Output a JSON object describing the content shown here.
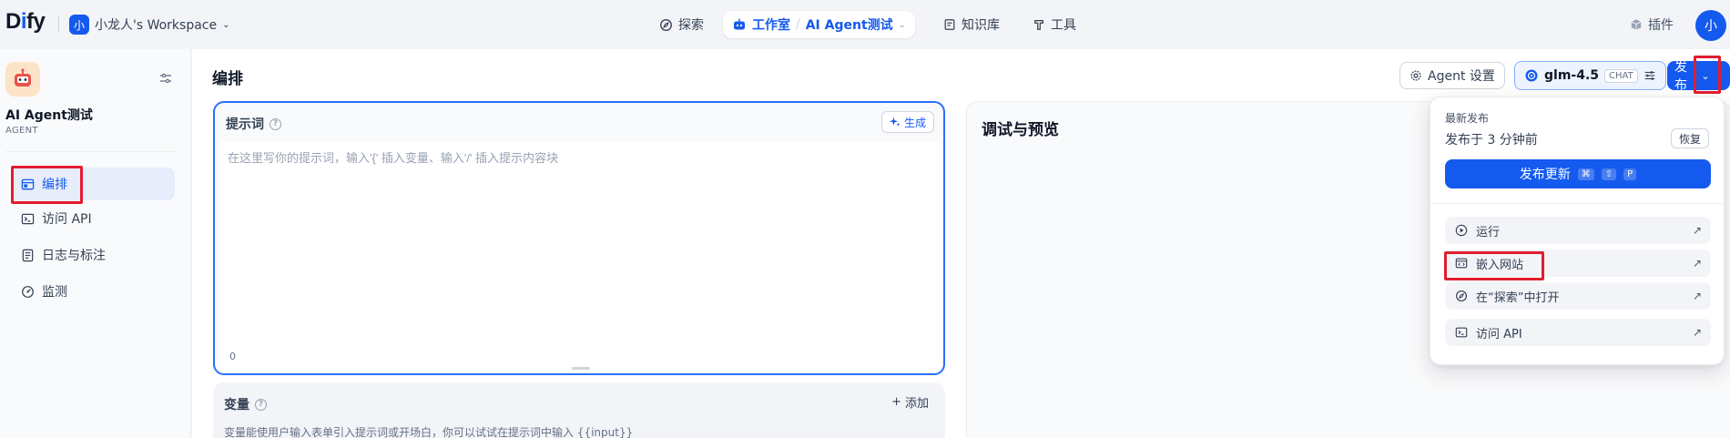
{
  "brand": {
    "logo": "Dify"
  },
  "workspace": {
    "avatar": "小",
    "name": "小龙人's Workspace"
  },
  "nav": {
    "explore": "探索",
    "studio": "工作室",
    "current_app": "AI Agent测试",
    "knowledge": "知识库",
    "tools": "工具",
    "plugins": "插件"
  },
  "user": {
    "avatar": "小"
  },
  "app": {
    "name": "AI Agent测试",
    "type": "AGENT"
  },
  "sidebar": {
    "items": [
      {
        "label": "编排",
        "icon": "layout-icon",
        "active": true
      },
      {
        "label": "访问 API",
        "icon": "terminal-icon"
      },
      {
        "label": "日志与标注",
        "icon": "file-list-icon"
      },
      {
        "label": "监测",
        "icon": "dashboard-icon"
      }
    ]
  },
  "main": {
    "title": "编排",
    "agent_settings": "Agent 设置",
    "model": {
      "name": "glm-4.5",
      "mode": "CHAT"
    },
    "publish": "发布",
    "prompt": {
      "label": "提示词",
      "generate": "生成",
      "placeholder": "在这里写你的提示词，输入'{' 插入变量、输入'/' 插入提示内容块",
      "count": "0"
    },
    "variables": {
      "label": "变量",
      "add": "添加",
      "desc": "变量能使用户输入表单引入提示词或开场白，你可以试试在提示词中输入 {{input}}"
    },
    "debug": {
      "title": "调试与预览"
    }
  },
  "publish_menu": {
    "subtitle": "最新发布",
    "published_time": "发布于 3 分钟前",
    "restore": "恢复",
    "update": "发布更新",
    "shortcut": [
      "⌘",
      "⇧",
      "P"
    ],
    "items": [
      {
        "label": "运行",
        "icon": "play-icon"
      },
      {
        "label": "嵌入网站",
        "icon": "embed-icon"
      },
      {
        "label": "在“探索”中打开",
        "icon": "compass-icon"
      },
      {
        "label": "访问 API",
        "icon": "terminal-icon"
      }
    ]
  },
  "colors": {
    "accent": "#155aef",
    "highlight": "#e11d2e"
  }
}
